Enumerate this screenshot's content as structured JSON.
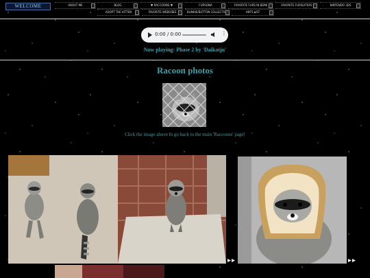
{
  "nav": {
    "welcome": "WELCOME",
    "row1": [
      "ABOUT ME",
      "BLOG",
      "♥ RACCOONS ♥",
      "FURSONA",
      "FAVORITE FURS IN BDMI",
      "FAVORITE FURSUITERS",
      "NINTENDO 3DS"
    ],
    "row2": [
      "ADOPT THE KITTEN",
      "FAVORITE WEBSITES",
      "BLINKIE/BUTTON COLLECTION",
      "ANTS LIST"
    ]
  },
  "audio": {
    "time": "0:00 / 0:00",
    "more": "⋮"
  },
  "now_playing": "Now playing: Phase 2 by 'Daikatju'",
  "page_title": "Racoon photos",
  "caption": "Click the image above to go back to the main 'Raccoons' page!",
  "colors": {
    "accent": "#3c9fa8",
    "background": "#000000"
  }
}
